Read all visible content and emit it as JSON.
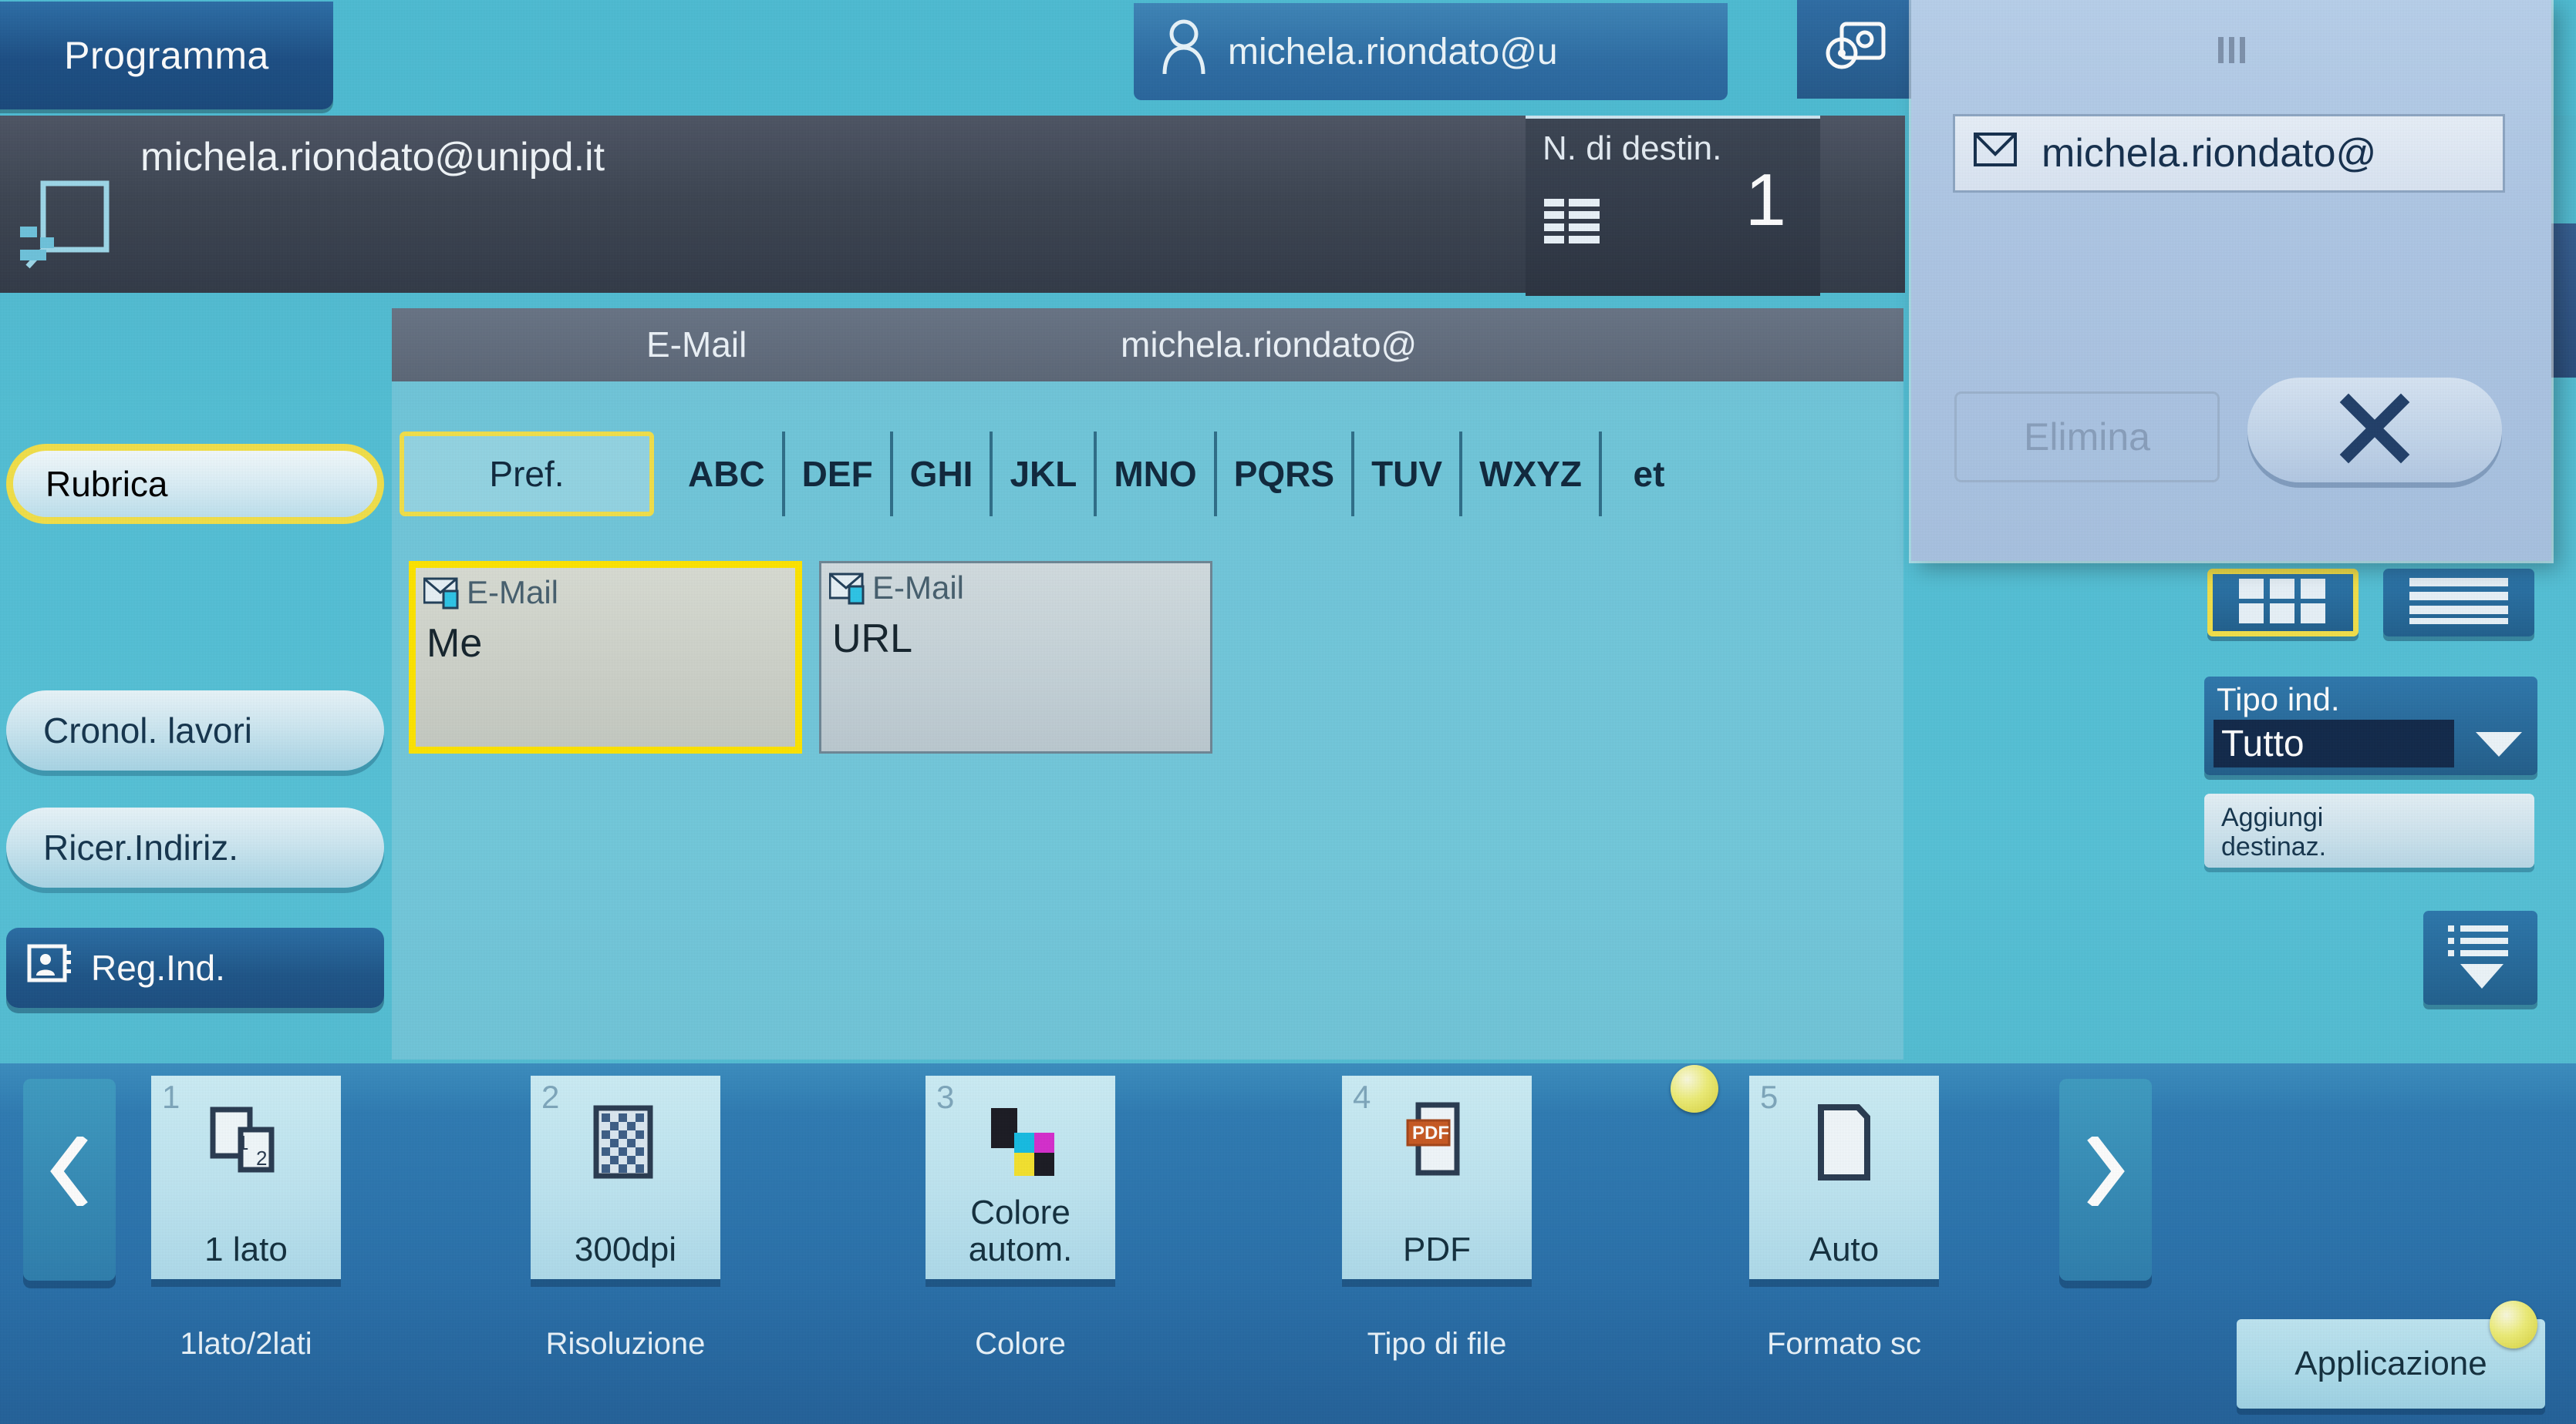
{
  "header": {
    "program_button": "Programma",
    "user_email": "michela.riondato@u",
    "user_icon": "person-icon",
    "settings_icon": "gear-speech-icon"
  },
  "address_bar": {
    "scan_icon": "scan-document-icon",
    "destination_email": "michela.riondato@unipd.it",
    "dest_count_label": "N. di destin.",
    "dest_count_icon": "list-table-icon",
    "dest_count_value": "1"
  },
  "tab_strip": {
    "type_label": "E-Mail",
    "address_preview": "michela.riondato@"
  },
  "sidebar": {
    "items": [
      {
        "label": "Rubrica",
        "selected": true,
        "style": "selected"
      },
      {
        "label": "Cronol. lavori",
        "selected": false,
        "style": "light"
      },
      {
        "label": "Ricer.Indiriz.",
        "selected": false,
        "style": "light"
      },
      {
        "label": "Reg.Ind.",
        "selected": false,
        "style": "dark",
        "icon": "address-card-icon"
      }
    ]
  },
  "alpha_tabs": {
    "items": [
      "Pref.",
      "ABC",
      "DEF",
      "GHI",
      "JKL",
      "MNO",
      "PQRS",
      "TUV",
      "WXYZ",
      "et"
    ],
    "selected": "Pref."
  },
  "contacts": [
    {
      "type": "E-Mail",
      "name": "Me",
      "icon": "email-envelope-icon",
      "selected": true
    },
    {
      "type": "E-Mail",
      "name": "URL",
      "icon": "email-envelope-icon",
      "selected": false
    }
  ],
  "right_panel": {
    "grid_view_icon": "grid-view-icon",
    "list_view_icon": "list-view-icon",
    "view_selected": "grid",
    "address_type_label": "Tipo ind.",
    "address_type_value": "Tutto",
    "address_type_caret": "chevron-down-icon",
    "add_destination_line1": "Aggiungi",
    "add_destination_line2": "destinaz.",
    "scroll_down_icon": "scroll-down-icon"
  },
  "popup": {
    "grip_icon": "drag-handle-icon",
    "item_icon": "envelope-icon",
    "item_label": "michela.riondato@",
    "delete_label": "Elimina",
    "delete_disabled": true,
    "close_icon": "close-x-icon",
    "collapse_icon": "double-left-arrow-icon"
  },
  "bottom_toolbar": {
    "prev_icon": "chevron-left-icon",
    "next_icon": "chevron-right-icon",
    "tiles": [
      {
        "num": "1",
        "value": "1 lato",
        "caption": "1lato/2lati",
        "icon": "duplex-pages-icon"
      },
      {
        "num": "2",
        "value": "300dpi",
        "caption": "Risoluzione",
        "icon": "halftone-grid-icon"
      },
      {
        "num": "3",
        "value": "Colore autom.",
        "caption": "Colore",
        "icon": "cmyk-swatches-icon"
      },
      {
        "num": "4",
        "value": "PDF",
        "caption": "Tipo di file",
        "icon": "pdf-file-icon",
        "badge": "yellow-dot"
      },
      {
        "num": "5",
        "value": "Auto",
        "caption": "Formato sc",
        "icon": "page-outline-icon"
      }
    ],
    "application_button": "Applicazione",
    "application_badge": "yellow-dot"
  },
  "colors": {
    "background": "#54c0d6",
    "panel_dark": "#3e4654",
    "accent_yellow": "#f3e14a",
    "select_yellow": "#ffe500",
    "button_blue": "#2d78ad",
    "popup_blue": "#afc8e6"
  }
}
